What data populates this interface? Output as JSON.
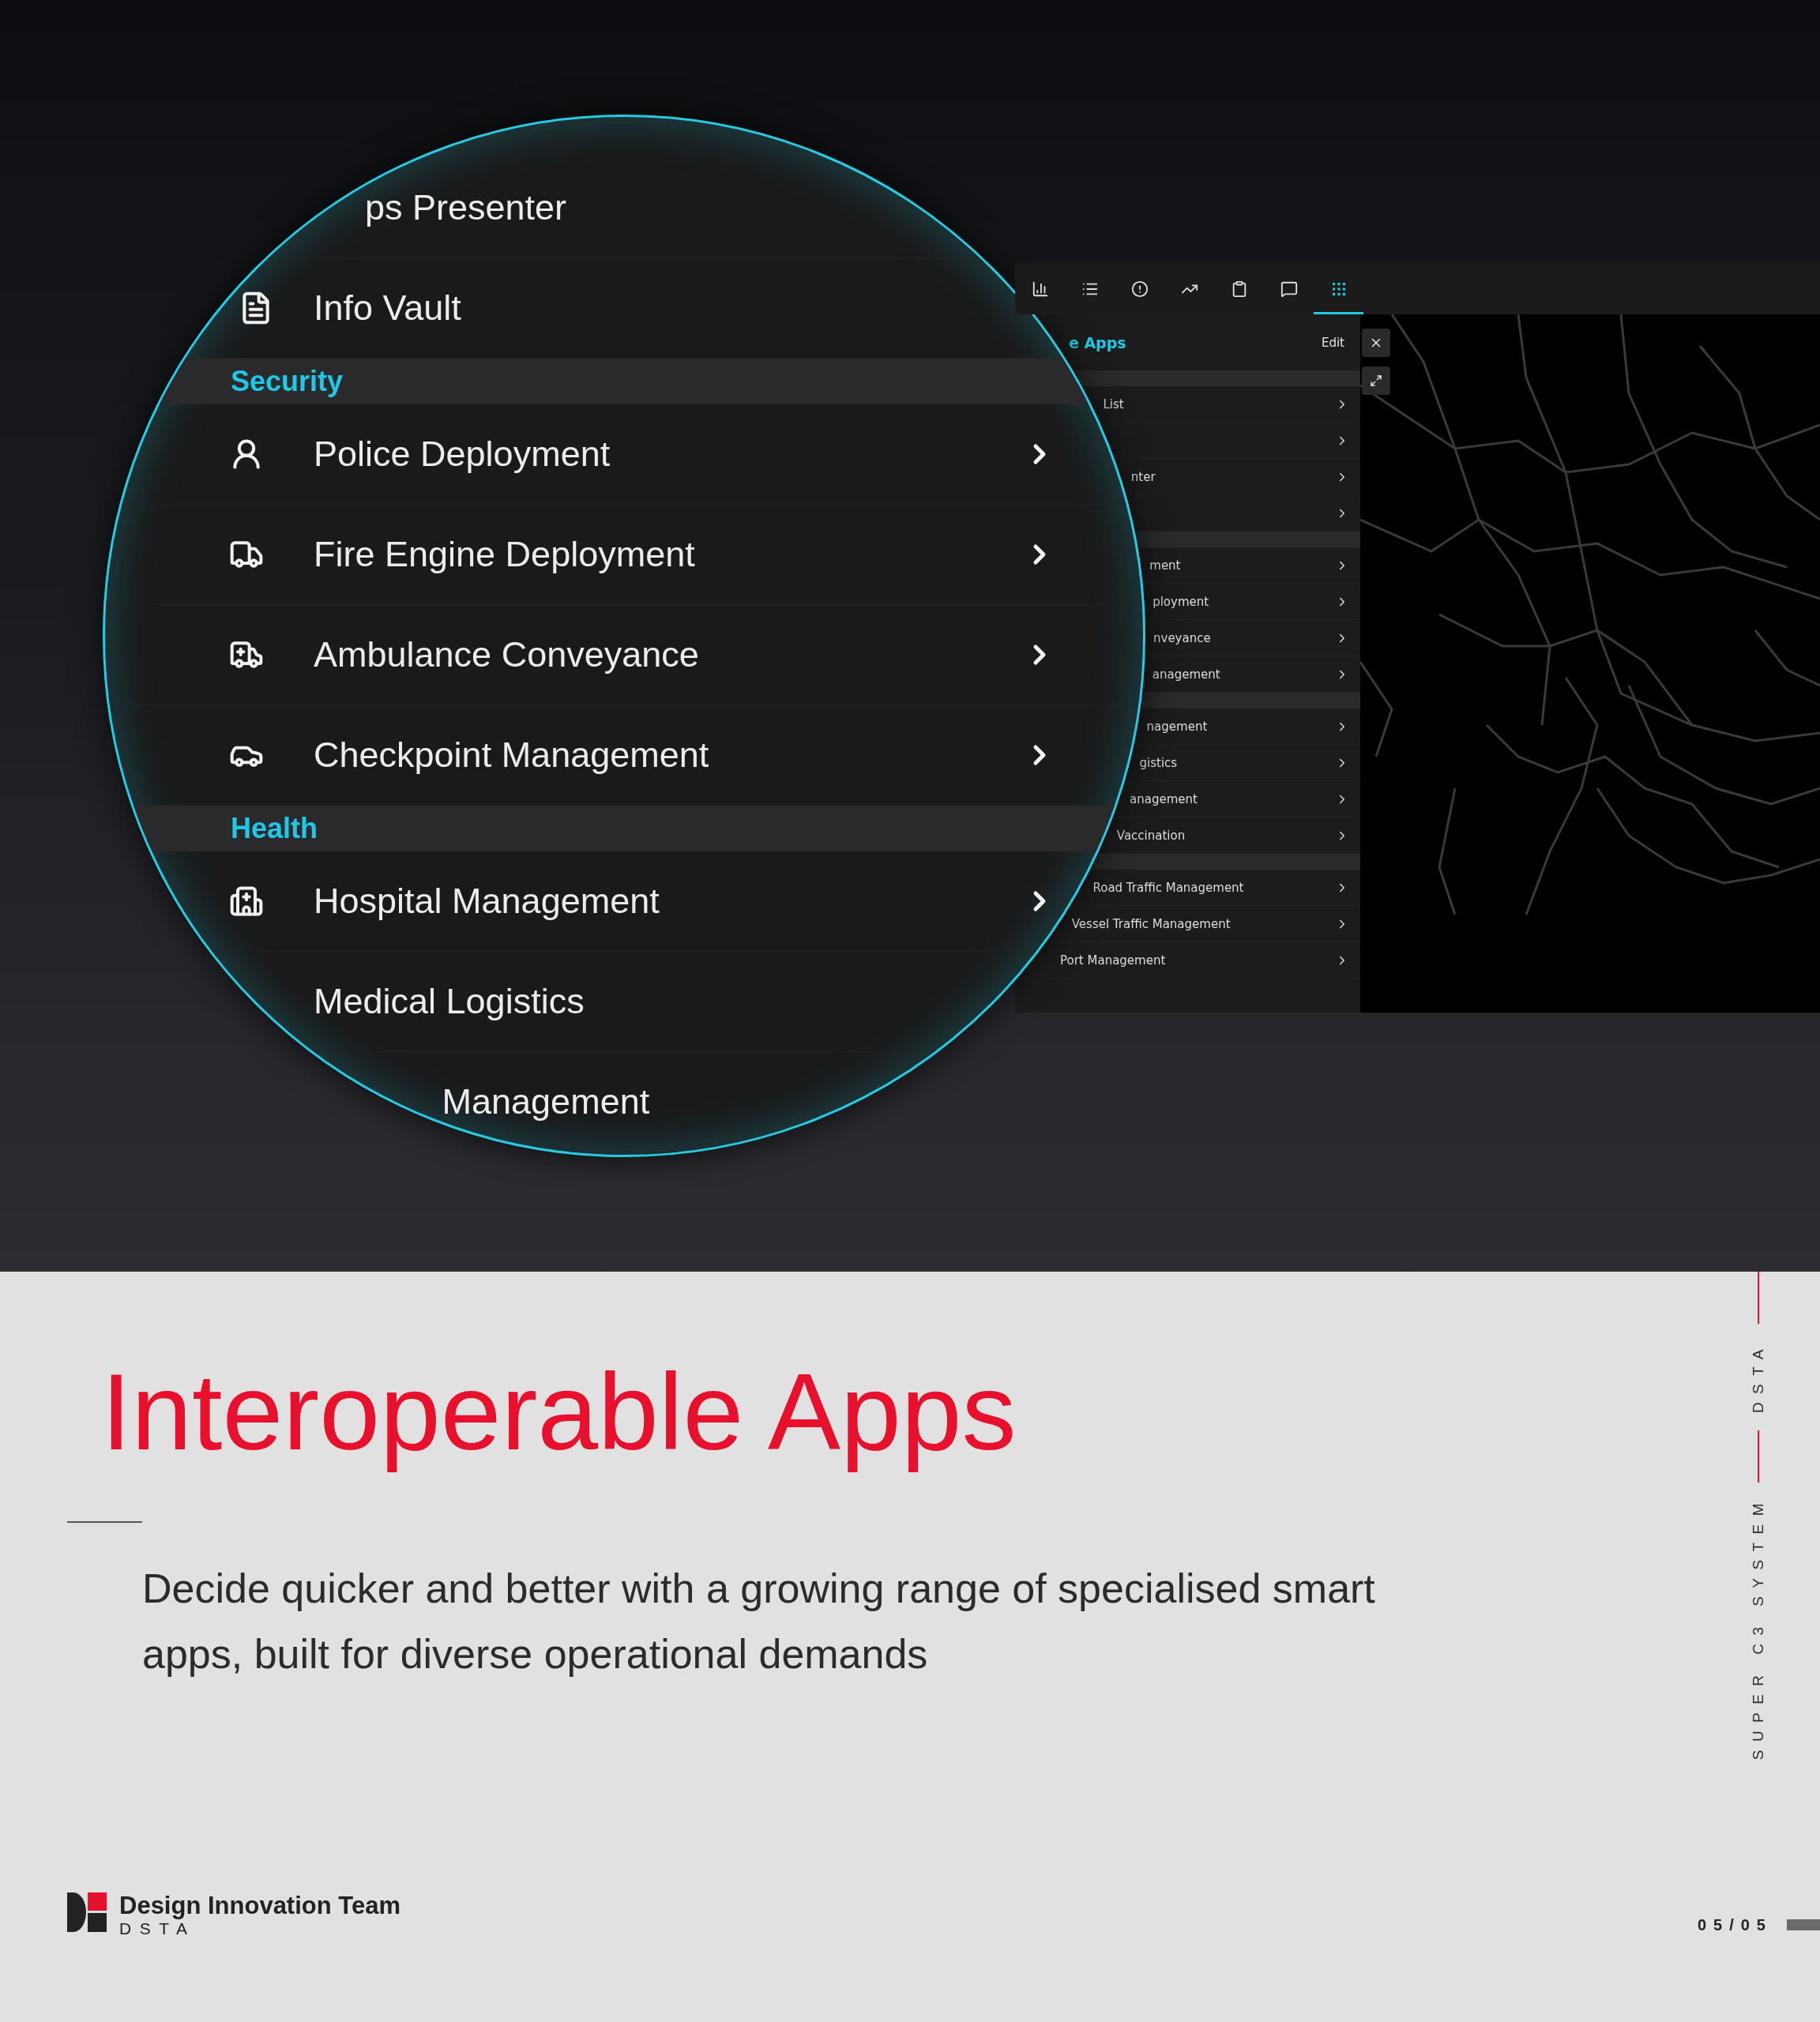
{
  "magnifier": {
    "rows": [
      {
        "kind": "item",
        "label": "ps Presenter"
      },
      {
        "kind": "item",
        "label": "Info Vault"
      },
      {
        "kind": "section",
        "label": "Security"
      },
      {
        "kind": "item",
        "label": "Police Deployment"
      },
      {
        "kind": "item",
        "label": "Fire Engine Deployment"
      },
      {
        "kind": "item",
        "label": "Ambulance Conveyance"
      },
      {
        "kind": "item",
        "label": "Checkpoint Management"
      },
      {
        "kind": "section",
        "label": "Health"
      },
      {
        "kind": "item",
        "label": "Hospital Management"
      },
      {
        "kind": "item",
        "label": "Medical Logistics"
      },
      {
        "kind": "item",
        "label": "Management"
      }
    ]
  },
  "app": {
    "toolbar": [
      {
        "selected": false
      },
      {
        "selected": false
      },
      {
        "selected": false
      },
      {
        "selected": false
      },
      {
        "selected": false
      },
      {
        "selected": false
      },
      {
        "selected": true
      }
    ],
    "panel": {
      "title": "e Apps",
      "edit": "Edit",
      "rows": [
        {
          "kind": "section"
        },
        {
          "kind": "item",
          "label": "List"
        },
        {
          "kind": "item"
        },
        {
          "kind": "item",
          "label": "nter"
        },
        {
          "kind": "item"
        },
        {
          "kind": "section"
        },
        {
          "kind": "item",
          "label": "ment"
        },
        {
          "kind": "item",
          "label": "ployment"
        },
        {
          "kind": "item",
          "label": "nveyance"
        },
        {
          "kind": "item",
          "label": "anagement"
        },
        {
          "kind": "section"
        },
        {
          "kind": "item",
          "label": "nagement"
        },
        {
          "kind": "item",
          "label": "gistics"
        },
        {
          "kind": "item",
          "label": "anagement"
        },
        {
          "kind": "item",
          "label": "Vaccination"
        },
        {
          "kind": "section"
        },
        {
          "kind": "item",
          "label": "Road Traffic Management"
        },
        {
          "kind": "item",
          "label": "Vessel Traffic Management"
        },
        {
          "kind": "item",
          "label": "Port Management"
        }
      ]
    }
  },
  "slide": {
    "title": "Interoperable Apps",
    "description": "Decide quicker and better with a growing range of specialised smart apps, built for diverse operational demands",
    "side_top": "DSTA",
    "side_bottom": "SUPER C3 SYSTEM",
    "logo_name": "Design Innovation Team",
    "logo_org": "DSTA",
    "page": "05/05"
  }
}
